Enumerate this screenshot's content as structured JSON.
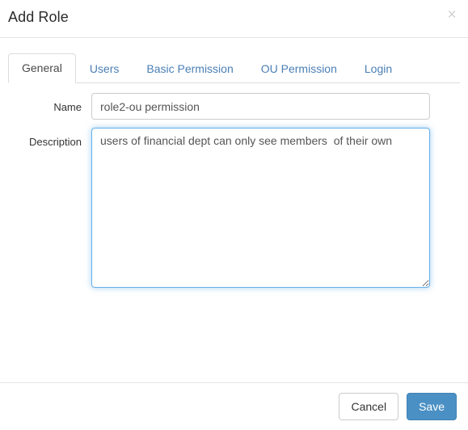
{
  "dialog": {
    "title": "Add Role",
    "close_icon": "close-icon",
    "close_glyph": "×"
  },
  "tabs": [
    {
      "label": "General",
      "active": true
    },
    {
      "label": "Users",
      "active": false
    },
    {
      "label": "Basic Permission",
      "active": false
    },
    {
      "label": "OU Permission",
      "active": false
    },
    {
      "label": "Login",
      "active": false
    }
  ],
  "form": {
    "name": {
      "label": "Name",
      "value": "role2-ou permission",
      "placeholder": ""
    },
    "description": {
      "label": "Description",
      "value": "users of financial dept can only see members  of their own",
      "placeholder": ""
    }
  },
  "footer": {
    "cancel_label": "Cancel",
    "save_label": "Save"
  },
  "colors": {
    "primary": "#4a90c4",
    "tab_link": "#4a7fb5",
    "focus_border": "#66afe9",
    "border": "#cccccc",
    "title_text": "#2b2b2b",
    "label_text": "#333333",
    "input_text": "#555555"
  }
}
